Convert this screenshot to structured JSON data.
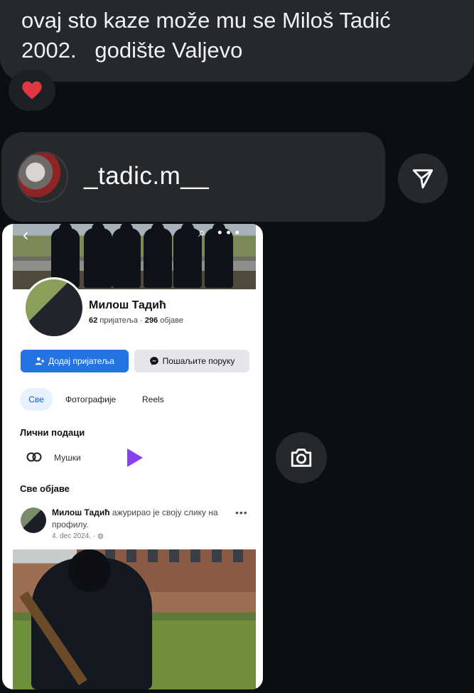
{
  "message": {
    "text": "ovaj sto kaze može mu se Miloš Tadić\n2002.   godište Valjevo",
    "reaction": "❤️"
  },
  "shared_post": {
    "username": "_tadic.m__",
    "share_icon": "send-icon",
    "camera_icon": "camera-icon"
  },
  "screenshot": {
    "profile_name": "Милош Тадић",
    "friends_count": "62",
    "friends_label": "пријатеља",
    "posts_count": "296",
    "posts_label": "објаве",
    "add_friend_label": "Додај пријатеља",
    "message_label": "Пошаљите поруку",
    "tabs": [
      "Све",
      "Фотографије",
      "Reels"
    ],
    "personal_info_heading": "Лични подаци",
    "gender_value": "Мушки",
    "all_posts_heading": "Све објаве",
    "post": {
      "author": "Милош Тадић",
      "action": "ажурирао је своју слику на профилу.",
      "date": "4. dec 2024."
    },
    "colors": {
      "accent_blue": "#2374e1",
      "play_purple": "#8a3ff0"
    }
  }
}
